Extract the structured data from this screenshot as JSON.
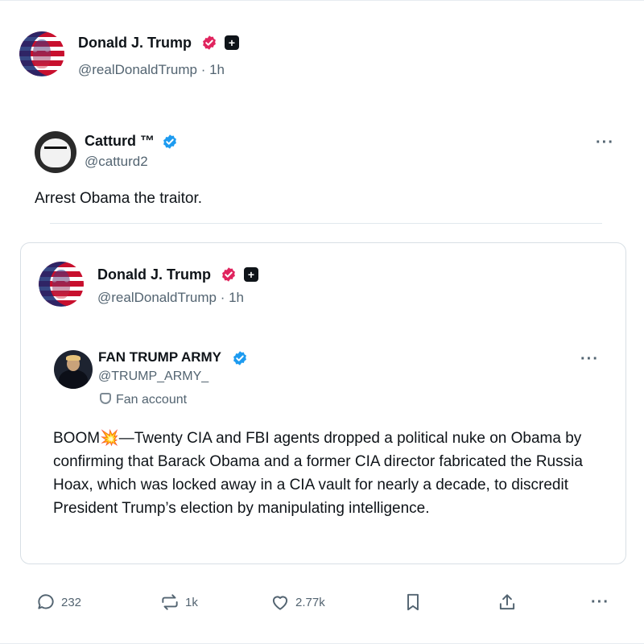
{
  "outer_post": {
    "author_name": "Donald J. Trump",
    "author_handle": "@realDonaldTrump",
    "time": "· 1h"
  },
  "reposted_post": {
    "author_name": "Catturd ™",
    "author_handle": "@catturd2",
    "text": "Arrest Obama the traitor.",
    "more_label": "···"
  },
  "quoted_post": {
    "author_name": "Donald J. Trump",
    "author_handle": "@realDonaldTrump",
    "time": "· 1h",
    "inner": {
      "author_name": "FAN TRUMP ARMY",
      "author_handle": "@TRUMP_ARMY_",
      "fan_label": "Fan account",
      "more_label": "···",
      "text": "BOOM💥—Twenty CIA and FBI agents dropped a political nuke on Obama by confirming that Barack Obama and a former CIA director fabricated the Russia Hoax, which was locked away in a CIA vault for nearly a decade, to discredit President Trump’s election by manipulating intelligence."
    }
  },
  "actions": {
    "replies": "232",
    "reposts": "1k",
    "likes": "2.77k",
    "more_label": "···"
  },
  "icons": {
    "verified_gold": "pink-verified-badge-icon",
    "verified_blue": "blue-verified-badge-icon",
    "affiliate": "plus-square-badge-icon",
    "reply": "reply-icon",
    "repost": "repost-icon",
    "like": "heart-icon",
    "bookmark": "bookmark-icon",
    "share": "share-icon"
  },
  "colors": {
    "text_primary": "#0f1419",
    "text_secondary": "#536471",
    "verified_blue": "#1d9bf0",
    "verified_pink": "#e0245e",
    "border": "#d8dfe5"
  }
}
